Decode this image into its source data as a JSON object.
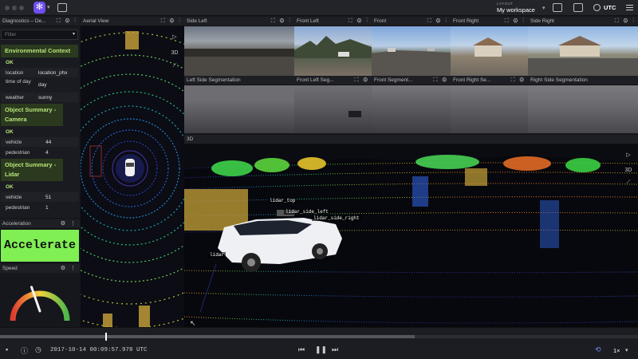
{
  "topbar": {
    "layout_label": "LAYOUT",
    "layout_value": "My workspace",
    "timezone": "UTC"
  },
  "panels": {
    "diagnostics": {
      "title": "Diagnostics – De..."
    },
    "aerial": {
      "title": "Aerial View"
    },
    "side_left": {
      "title": "Side Left"
    },
    "front_left": {
      "title": "Front Left"
    },
    "front": {
      "title": "Front"
    },
    "front_right": {
      "title": "Front Right"
    },
    "side_right": {
      "title": "Side Right"
    },
    "left_side_seg": {
      "title": "Left Side Segmentation"
    },
    "front_left_seg": {
      "title": "Front Left Seg..."
    },
    "front_seg": {
      "title": "Front Segment..."
    },
    "front_right_seg": {
      "title": "Front Right Se..."
    },
    "right_side_seg": {
      "title": "Right Side Segmentation"
    },
    "view3d": {
      "title": "3D"
    },
    "acceleration": {
      "title": "Acceleration"
    },
    "speed": {
      "title": "Speed"
    }
  },
  "diagnostics": {
    "filter_placeholder": "Filter",
    "sections": [
      {
        "title": "Environmental Context",
        "status": "OK",
        "rows": [
          {
            "key": "location",
            "value": "location_phx"
          },
          {
            "key": "time of day",
            "value": "day"
          },
          {
            "key": "weather",
            "value": "sunny"
          }
        ]
      },
      {
        "title": "Object Summary - Camera",
        "status": "OK",
        "rows": [
          {
            "key": "vehicle",
            "value": "44"
          },
          {
            "key": "pedestrian",
            "value": "4"
          }
        ]
      },
      {
        "title": "Object Summary - Lidar",
        "status": "OK",
        "rows": [
          {
            "key": "vehicle",
            "value": "51"
          },
          {
            "key": "pedestrian",
            "value": "1"
          }
        ]
      }
    ]
  },
  "acceleration": {
    "state": "Accelerate",
    "color": "#7fef53"
  },
  "speed": {
    "needle_fraction": 0.42
  },
  "view_controls": {
    "mode_3d": "3D"
  },
  "labels_3d": [
    "lidar_top",
    "lidar_side_left",
    "lidar_side_right",
    "lidar"
  ],
  "timeline": {
    "timestamp": "2017-10-14 00:09:57.978 UTC",
    "progress": 0.65,
    "playhead": 0.165,
    "speed": "1×"
  },
  "colors": {
    "accent": "#6f4ff2",
    "ok_green": "#b6e37a"
  }
}
